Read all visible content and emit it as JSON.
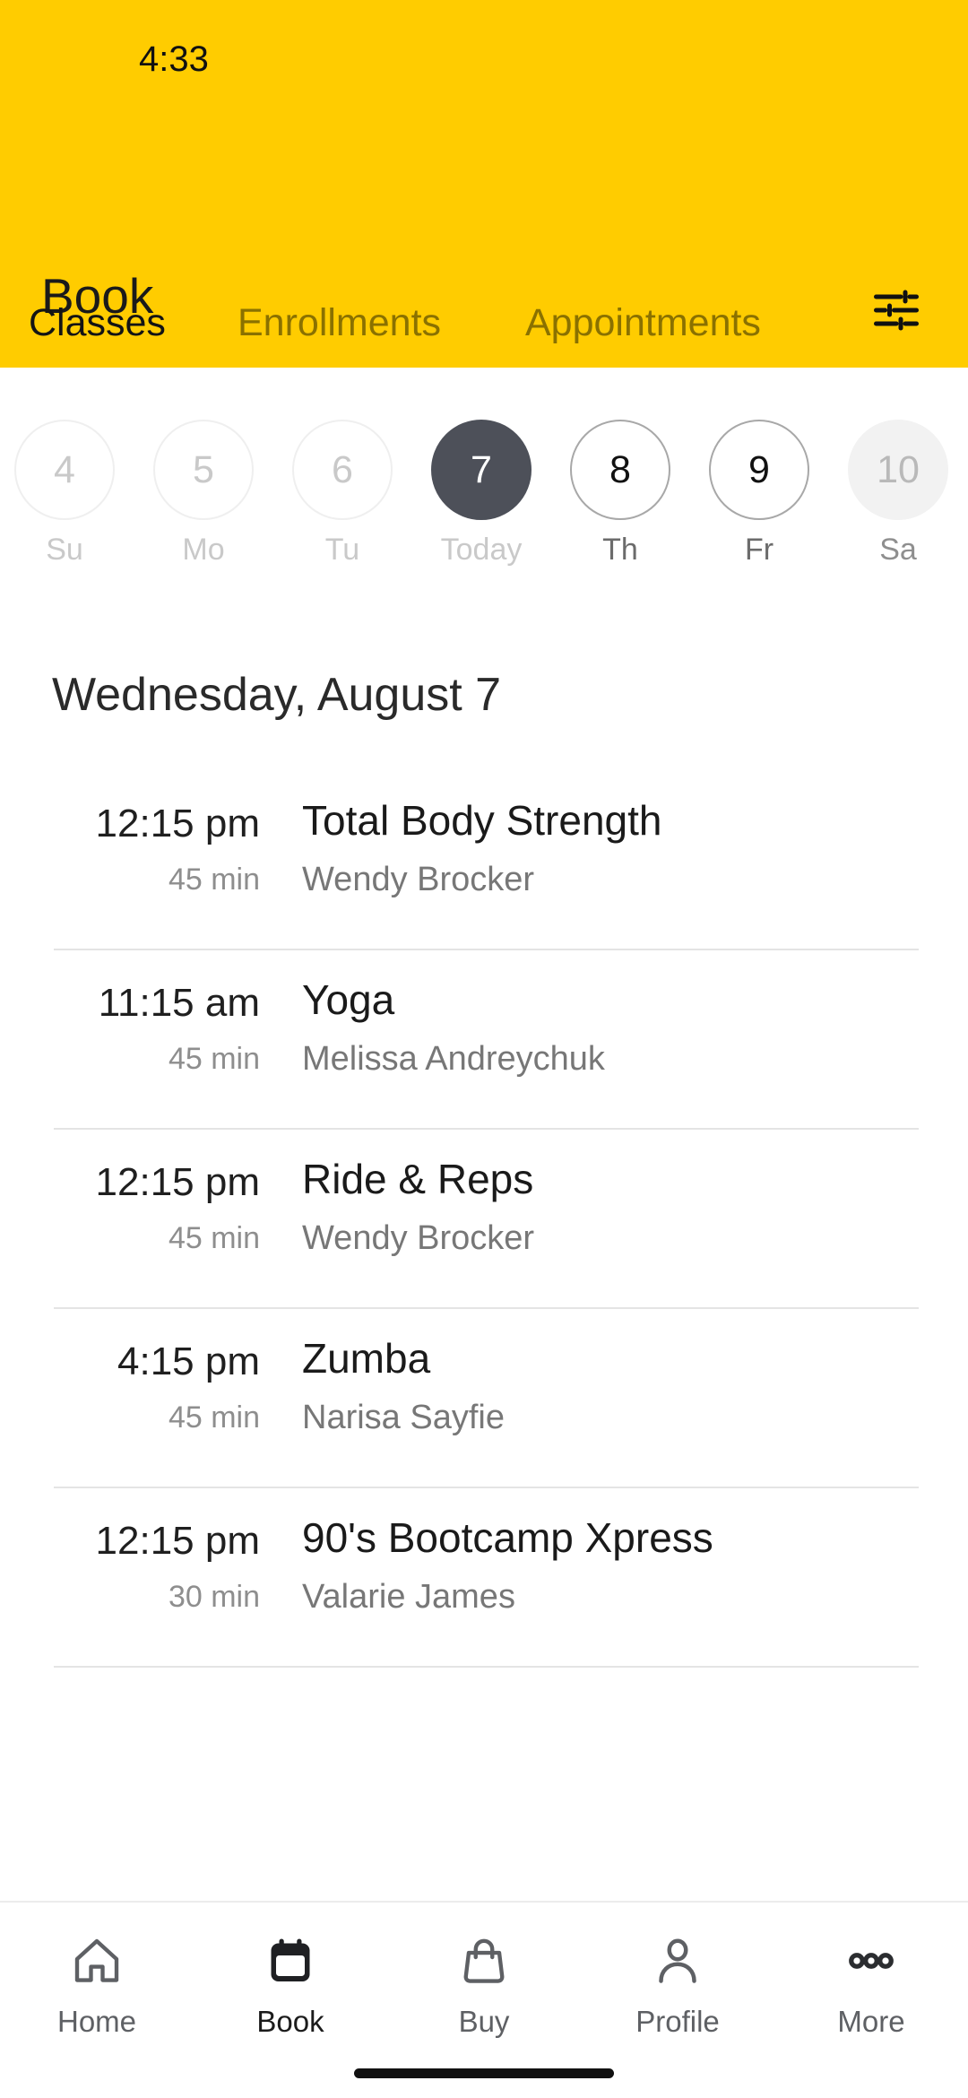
{
  "status_bar": {
    "time": "4:33"
  },
  "header": {
    "title": "Book",
    "accent_color": "#FFCC00",
    "filter_icon": "tune-filter-icon"
  },
  "tabs": [
    {
      "label": "Classes",
      "active": true
    },
    {
      "label": "Enrollments",
      "active": false
    },
    {
      "label": "Appointments",
      "active": false
    }
  ],
  "date_strip": [
    {
      "day": "4",
      "weekday": "Su",
      "state": "past"
    },
    {
      "day": "5",
      "weekday": "Mo",
      "state": "past"
    },
    {
      "day": "6",
      "weekday": "Tu",
      "state": "past"
    },
    {
      "day": "7",
      "weekday": "Today",
      "state": "today"
    },
    {
      "day": "8",
      "weekday": "Th",
      "state": "future"
    },
    {
      "day": "9",
      "weekday": "Fr",
      "state": "future"
    },
    {
      "day": "10",
      "weekday": "Sa",
      "state": "muted"
    }
  ],
  "selected_date_heading": "Wednesday, August 7",
  "classes": [
    {
      "time": "12:15 pm",
      "duration": "45 min",
      "title": "Total Body Strength",
      "instructor": "Wendy Brocker"
    },
    {
      "time": "11:15 am",
      "duration": "45 min",
      "title": "Yoga",
      "instructor": "Melissa Andreychuk"
    },
    {
      "time": "12:15 pm",
      "duration": "45 min",
      "title": "Ride & Reps",
      "instructor": "Wendy Brocker"
    },
    {
      "time": "4:15 pm",
      "duration": "45 min",
      "title": "Zumba",
      "instructor": "Narisa Sayfie"
    },
    {
      "time": "12:15 pm",
      "duration": "30 min",
      "title": "90's Bootcamp Xpress",
      "instructor": "Valarie James"
    }
  ],
  "bottom_nav": [
    {
      "label": "Home",
      "icon": "home-icon",
      "active": false
    },
    {
      "label": "Book",
      "icon": "calendar-icon",
      "active": true
    },
    {
      "label": "Buy",
      "icon": "bag-icon",
      "active": false
    },
    {
      "label": "Profile",
      "icon": "person-icon",
      "active": false
    },
    {
      "label": "More",
      "icon": "more-dots-icon",
      "active": false
    }
  ],
  "colors": {
    "brand_yellow": "#FFCC00",
    "today_circle": "#4D5059",
    "text_primary": "#1a1a1a",
    "text_secondary": "#777777"
  }
}
